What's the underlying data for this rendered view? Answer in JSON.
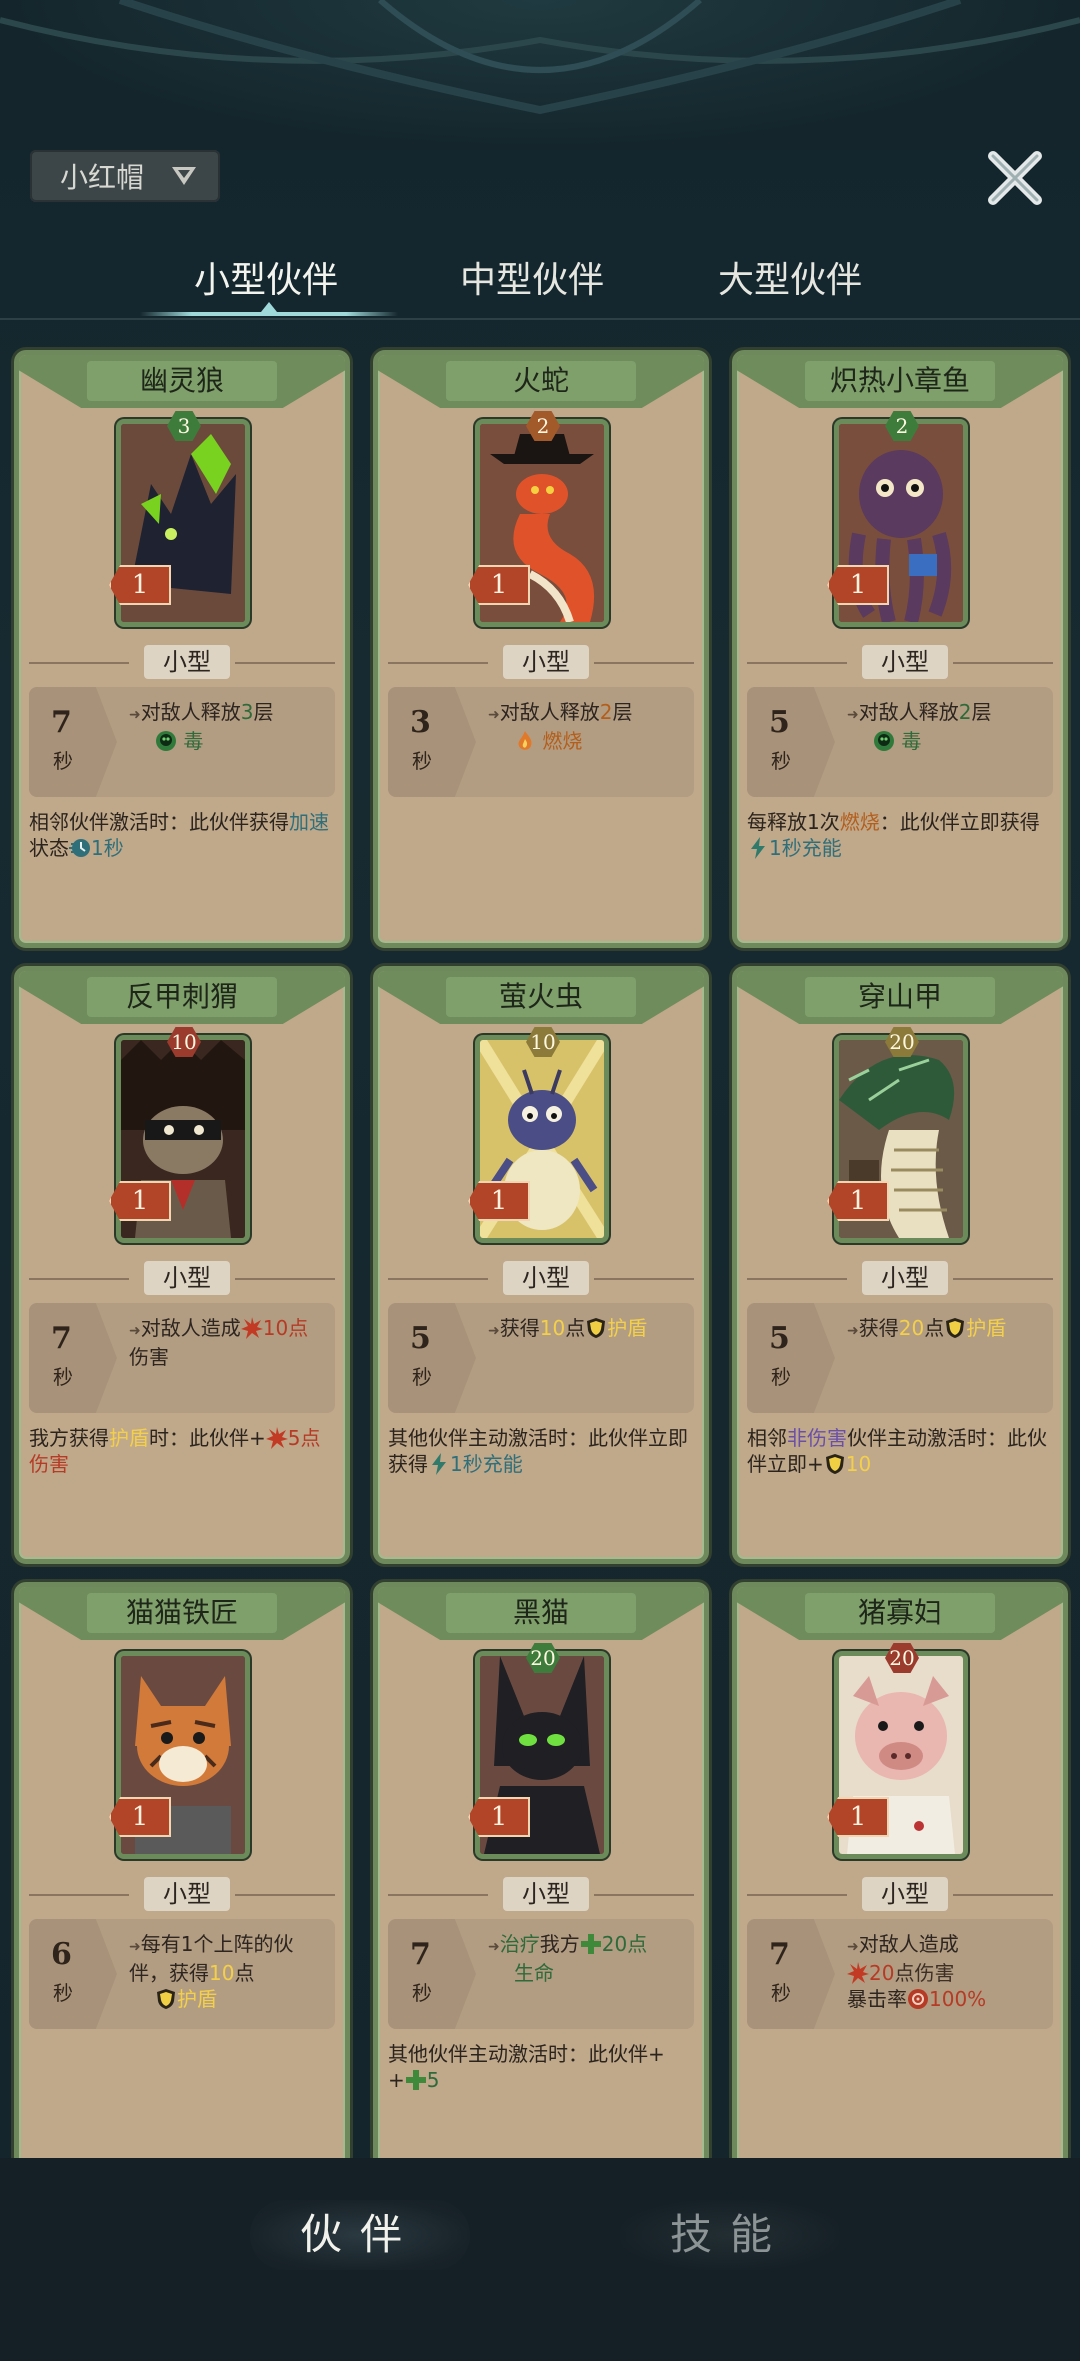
{
  "header": {
    "character": "小红帽",
    "close_icon": "close-x-icon"
  },
  "tabs": [
    {
      "label": "小型伙伴",
      "active": true
    },
    {
      "label": "中型伙伴",
      "active": false
    },
    {
      "label": "大型伙伴",
      "active": false
    }
  ],
  "size_label": "小型",
  "time_unit": "秒",
  "cards": [
    {
      "name": "幽灵狼",
      "cost": "3",
      "level": "1",
      "badge_color": "#3e7c3c",
      "timer": "7",
      "effect_line1": "对敌人释放",
      "effect_value": "3",
      "effect_suffix": "层",
      "effect_icon": "poison-skull-icon",
      "effect_keyword": "毒",
      "passive_a": "相邻伙伴激活时：此伙伴获得",
      "passive_kw": "加速",
      "passive_b": "状态",
      "passive_c": "1秒"
    },
    {
      "name": "火蛇",
      "cost": "2",
      "level": "1",
      "badge_color": "#a35a2b",
      "timer": "3",
      "effect_line1": "对敌人释放",
      "effect_value": "2",
      "effect_suffix": "层",
      "effect_icon": "burn-flame-icon",
      "effect_keyword": "燃烧"
    },
    {
      "name": "炽热小章鱼",
      "cost": "2",
      "level": "1",
      "badge_color": "#3e7c3c",
      "timer": "5",
      "effect_line1": "对敌人释放",
      "effect_value": "2",
      "effect_suffix": "层",
      "effect_icon": "poison-skull-icon",
      "effect_keyword": "毒",
      "passive_a": "每释放1次",
      "passive_kw": "燃烧",
      "passive_b": "：此伙伴立即获得",
      "passive_c": "1秒",
      "passive_d": "充能"
    },
    {
      "name": "反甲刺猬",
      "cost": "10",
      "level": "1",
      "badge_color": "#9a3b2e",
      "timer": "7",
      "effect_line1": "对敌人造成",
      "effect_value": "10",
      "effect_suffix": "点",
      "effect_icon": "damage-burst-icon",
      "effect_keyword": "伤害",
      "passive_a": "我方获得",
      "passive_kw": "护盾",
      "passive_b": "时：此伙伴+",
      "passive_c": "5点",
      "passive_d": "伤害"
    },
    {
      "name": "萤火虫",
      "cost": "10",
      "level": "1",
      "badge_color": "#8c7a3a",
      "timer": "5",
      "effect_line1": "获得",
      "effect_value": "10",
      "effect_suffix": "点",
      "effect_icon": "shield-icon",
      "effect_keyword": "护盾",
      "passive_a": "其他伙伴主动激活时：此伙伴立即获得",
      "passive_c": "1秒",
      "passive_d": "充能"
    },
    {
      "name": "穿山甲",
      "cost": "20",
      "level": "1",
      "badge_color": "#8c7a3a",
      "timer": "5",
      "effect_line1": "获得",
      "effect_value": "20",
      "effect_suffix": "点",
      "effect_icon": "shield-icon",
      "effect_keyword": "护盾",
      "passive_a": "相邻",
      "passive_kw": "非伤害",
      "passive_b": "伙伴主动激活时：此伙伴立即+",
      "passive_c": "10"
    },
    {
      "name": "猫猫铁匠",
      "cost": "",
      "level": "1",
      "badge_color": "#6b4a3a",
      "timer": "6",
      "effect_line1": "每有1个上阵的伙伴，获得",
      "effect_value": "10",
      "effect_suffix": "点",
      "effect_icon": "shield-icon",
      "effect_keyword": "护盾"
    },
    {
      "name": "黑猫",
      "cost": "20",
      "level": "1",
      "badge_color": "#3e7c3c",
      "timer": "7",
      "effect_kw_first": "治疗",
      "effect_line1": "我方",
      "effect_value": "20",
      "effect_suffix": "点",
      "effect_icon": "heal-cross-icon",
      "effect_keyword": "生命",
      "passive_a": "其他伙伴主动激活时：此伙伴+",
      "passive_c": "5"
    },
    {
      "name": "猪寡妇",
      "cost": "20",
      "level": "1",
      "badge_color": "#9a3b2e",
      "timer": "7",
      "effect_line1": "对敌人造成",
      "effect_value": "20",
      "effect_suffix": "点伤害",
      "effect_icon": "damage-burst-icon",
      "effect_line3": "暴击率",
      "effect_crit": "100%"
    }
  ],
  "bottom_nav": [
    {
      "label": "伙伴",
      "active": true
    },
    {
      "label": "技能",
      "active": false
    }
  ],
  "colors": {
    "card_bg": "#c0a88b",
    "card_border": "#6e8a5c",
    "level_tag": "#b24427",
    "background": "#172a31"
  }
}
